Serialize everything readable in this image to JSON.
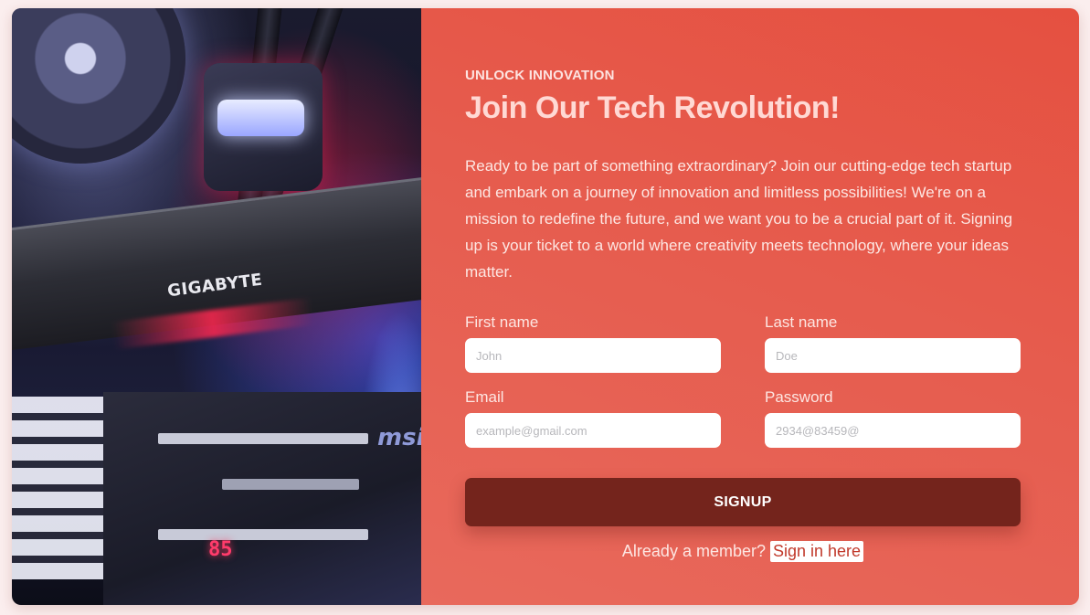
{
  "hero": {
    "gpu_brand_text": "GIGABYTE",
    "board_brand_text": "msi",
    "debug_digits": "85"
  },
  "form": {
    "kicker": "UNLOCK INNOVATION",
    "title": "Join Our Tech Revolution!",
    "description": "Ready to be part of something extraordinary? Join our cutting-edge tech startup and embark on a journey of innovation and limitless possibilities! We're on a mission to redefine the future, and we want you to be a crucial part of it. Signing up is your ticket to a world where creativity meets technology, where your ideas matter.",
    "first_name": {
      "label": "First name",
      "placeholder": "John",
      "value": ""
    },
    "last_name": {
      "label": "Last name",
      "placeholder": "Doe",
      "value": ""
    },
    "email": {
      "label": "Email",
      "placeholder": "example@gmail.com",
      "value": ""
    },
    "password": {
      "label": "Password",
      "placeholder": "2934@83459@",
      "value": ""
    },
    "signup_label": "SIGNUP",
    "member_text": "Already a member?",
    "signin_label": "Sign in here"
  },
  "colors": {
    "panel_accent": "#e55040",
    "button": "#74241c",
    "page_background": "#fbeeee"
  }
}
